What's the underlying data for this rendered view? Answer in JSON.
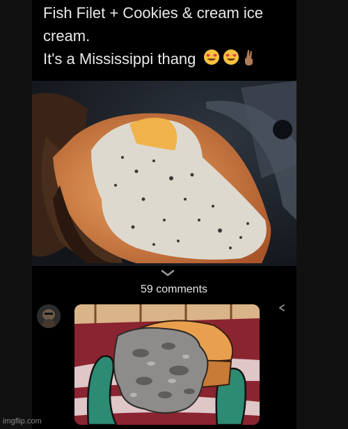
{
  "post": {
    "line1": "Fish Filet + Cookies & cream ice",
    "line2": "cream.",
    "line3": "It's a Mississippi thang",
    "emoji_icons": [
      "heart-eyes-emoji",
      "heart-eyes-emoji",
      "crossed-fingers-emoji"
    ]
  },
  "comments": {
    "label": "59 comments"
  },
  "watermark": {
    "text": "imgflip.com"
  },
  "colors": {
    "background": "#000000",
    "text": "#e9e9e9",
    "bun": "#d98a47",
    "ice_cream": "#ddd9cf",
    "plate": "#8a2430"
  }
}
